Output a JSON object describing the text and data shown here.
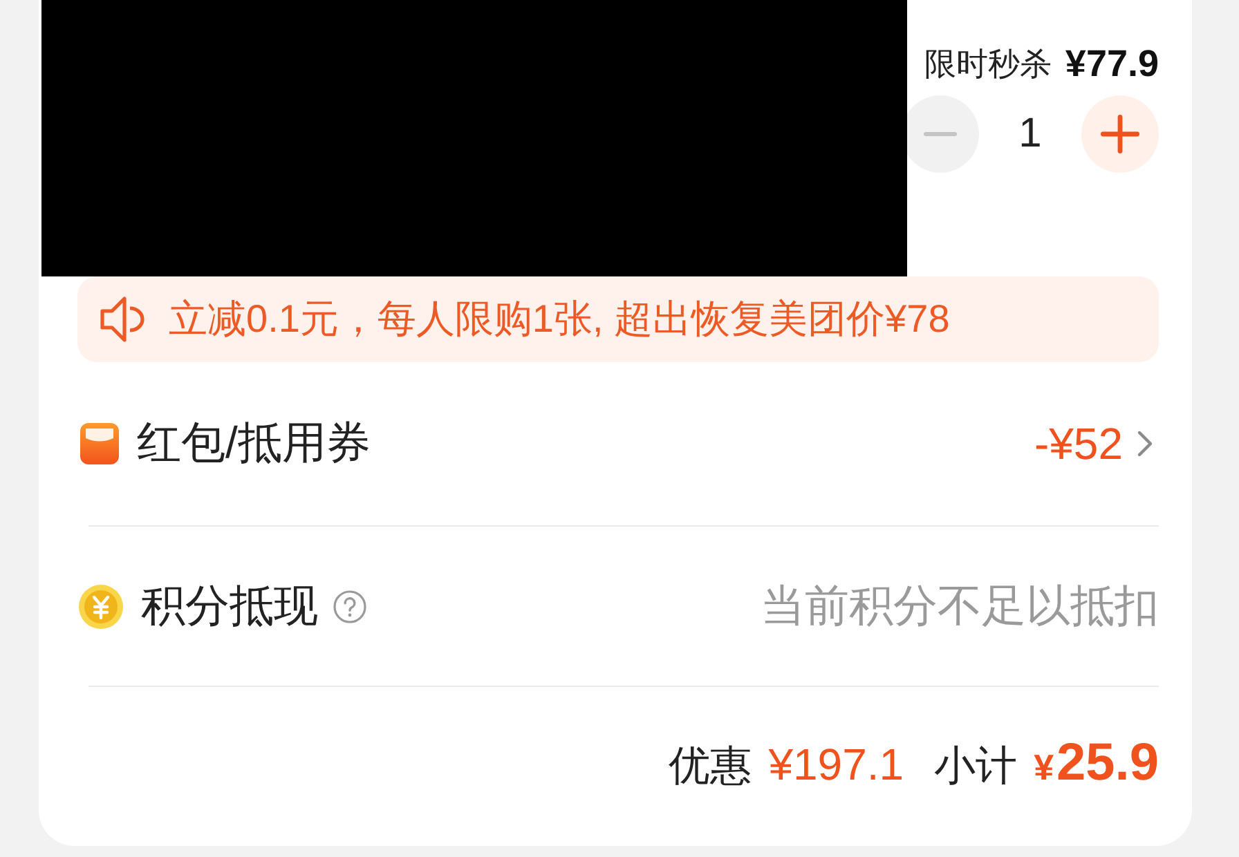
{
  "product": {
    "promo_label": "限时秒杀",
    "price": "¥77.9"
  },
  "quantity": {
    "value": "1",
    "decrease_disabled": true,
    "increase_disabled": false
  },
  "notice": {
    "text": "立减0.1元，每人限购1张, 超出恢复美团价¥78"
  },
  "options": [
    {
      "kind": "coupon",
      "label": "红包/抵用券",
      "value": "-¥52",
      "disabled": false,
      "has_help": false,
      "has_chevron": true
    },
    {
      "kind": "points",
      "label": "积分抵现",
      "value": "当前积分不足以抵扣",
      "disabled": true,
      "has_help": true,
      "has_chevron": false
    }
  ],
  "summary": {
    "discount_label": "优惠",
    "discount": "¥197.1",
    "subtotal_label": "小计",
    "subtotal_currency": "¥",
    "subtotal": "25.9"
  }
}
